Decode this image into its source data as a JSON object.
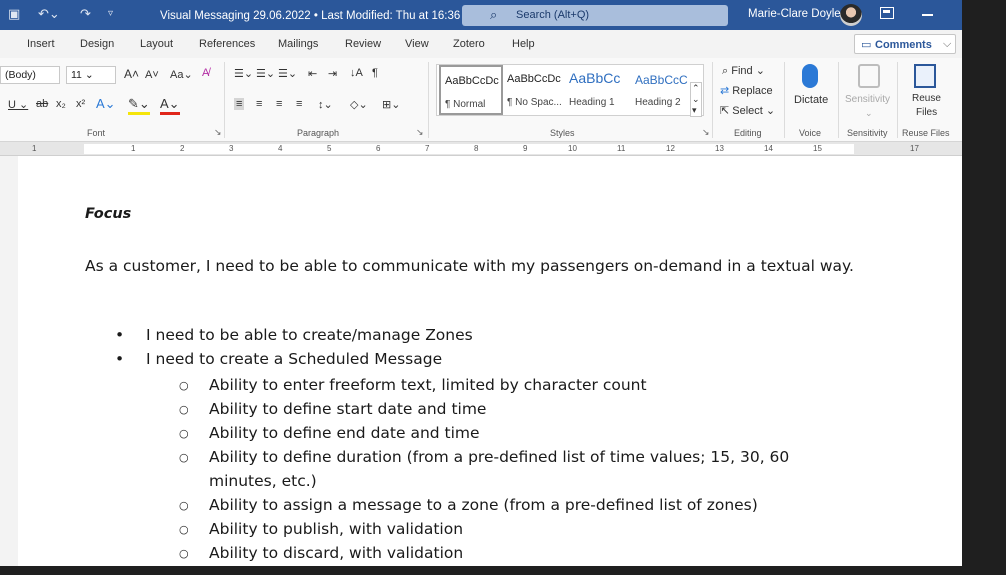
{
  "titlebar": {
    "doc_title": "Visual Messaging 29.06.2022 • Last Modified: Thu at 16:36 ⌄",
    "search_placeholder": "Search (Alt+Q)",
    "user_name": "Marie-Clare Doyle"
  },
  "tabs": [
    "Insert",
    "Design",
    "Layout",
    "References",
    "Mailings",
    "Review",
    "View",
    "Zotero",
    "Help"
  ],
  "comments_label": "Comments",
  "ribbon": {
    "font_name": "(Body)",
    "font_size": "11",
    "groups": {
      "font": "Font",
      "paragraph": "Paragraph",
      "styles": "Styles",
      "editing": "Editing",
      "voice": "Voice",
      "sensitivity": "Sensitivity",
      "reuse": "Reuse Files"
    },
    "styles": [
      {
        "preview": "AaBbCcDc",
        "name": "¶ Normal"
      },
      {
        "preview": "AaBbCcDc",
        "name": "¶ No Spac..."
      },
      {
        "preview": "AaBbCc",
        "name": "Heading 1"
      },
      {
        "preview": "AaBbCcC",
        "name": "Heading 2"
      }
    ],
    "editing": {
      "find": "Find",
      "replace": "Replace",
      "select": "Select"
    },
    "dictate": "Dictate",
    "sensitivity_btn": "Sensitivity",
    "reuse_btn_1": "Reuse",
    "reuse_btn_2": "Files"
  },
  "ruler_numbers": [
    "1",
    "1",
    "2",
    "3",
    "4",
    "5",
    "6",
    "7",
    "8",
    "9",
    "10",
    "11",
    "12",
    "13",
    "14",
    "15",
    "17"
  ],
  "document": {
    "heading": "Focus",
    "intro": "As a customer, I need to be able to communicate with my passengers on-demand in a textual way.",
    "bullets": [
      "I need to be able to create/manage Zones",
      "I need to create a Scheduled Message"
    ],
    "sub_bullets": [
      "Ability to enter freeform text, limited by character count",
      "Ability to define start date and time",
      "Ability to define end date and time",
      "Ability to define duration (from a pre-defined list of time values; 15, 30, 60 minutes, etc.)",
      "Ability to assign a message to a zone (from a pre-defined list of zones)",
      "Ability to publish, with validation",
      "Ability to discard, with validation"
    ]
  },
  "colors": {
    "titlebar": "#2b579a",
    "accent": "#2b579a",
    "font_color_red": "#e0261b",
    "highlight_yellow": "#f5e50a"
  }
}
